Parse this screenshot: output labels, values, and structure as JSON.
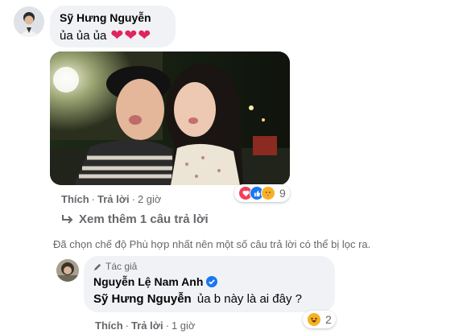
{
  "comment1": {
    "author": "Sỹ Hưng Nguyễn",
    "text": "ủa ủa ủa",
    "hearts": [
      "❤",
      "❤",
      "❤"
    ],
    "actions": {
      "like": "Thích",
      "reply": "Trả lời",
      "time": "2 giờ"
    },
    "reactions": {
      "icons": [
        "heart-icon",
        "like-icon",
        "care-icon"
      ],
      "count": "9"
    },
    "photo_alt": "selfie of a couple at night"
  },
  "more_replies": "Xem thêm 1 câu trả lời",
  "filter_notice": "Đã chọn chế độ Phù hợp nhất nên một số câu trả lời có thể bị lọc ra.",
  "reply": {
    "author_badge": "Tác giả",
    "author": "Nguyễn Lệ Nam Anh",
    "mention": "Sỹ Hưng Nguyễn",
    "text": "ủa b này là ai đây ?",
    "actions": {
      "like": "Thích",
      "reply": "Trả lời",
      "time": "1 giờ"
    },
    "reactions": {
      "icons": [
        "haha-icon"
      ],
      "count": "2"
    }
  },
  "colors": {
    "bubble": "#f0f2f5",
    "link_blue": "#1877f2",
    "heart": "#e0245e",
    "secondary": "#65676b"
  }
}
